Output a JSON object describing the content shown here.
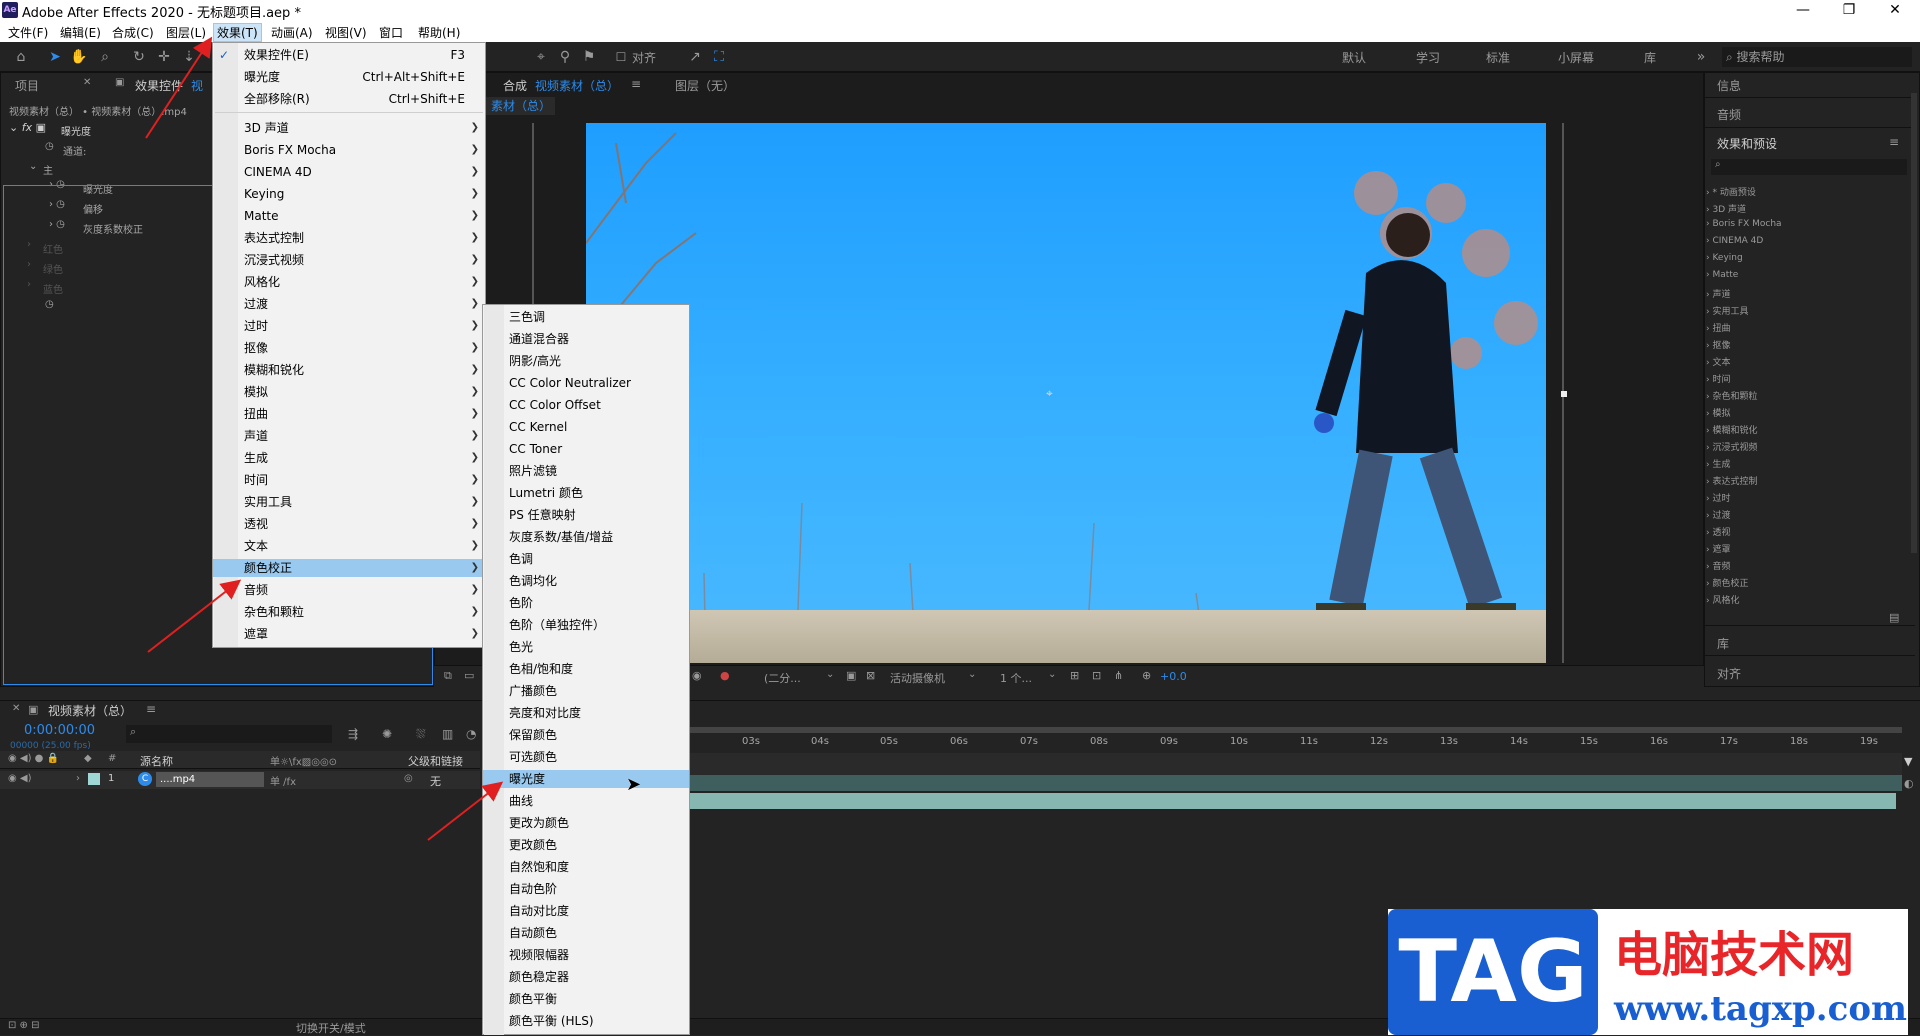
{
  "window": {
    "app_icon": "Ae",
    "title": "Adobe After Effects 2020 - 无标题项目.aep *",
    "min": "—",
    "max": "❐",
    "close": "✕"
  },
  "menubar": [
    "文件(F)",
    "编辑(E)",
    "合成(C)",
    "图层(L)",
    "效果(T)",
    "动画(A)",
    "视图(V)",
    "窗口",
    "帮助(H)"
  ],
  "toolbar": {
    "snap_label": "对齐",
    "workspaces": [
      "默认",
      "学习",
      "标准",
      "小屏幕",
      "库"
    ],
    "search_help": "搜索帮助"
  },
  "left_panel": {
    "tabs": [
      "项目",
      "效果控件",
      "视"
    ],
    "breadcrumb": "视频素材（总） • 视频素材（总）.mp4",
    "effect_name": "曝光度",
    "rows": [
      "通道:",
      "主",
      "曝光度",
      "偏移",
      "灰度系数校正",
      "红色",
      "绿色",
      "蓝色"
    ]
  },
  "comp_panel": {
    "tab_prefix": "合成",
    "tab_name": "视频素材（总）",
    "layer_tab": "图层（无）",
    "comp_label": "素材（总）"
  },
  "viewer_bar": {
    "resolution": "(二分...",
    "camera": "活动摄像机",
    "views": "1 个...",
    "exposure": "+0.0"
  },
  "effects_menu": {
    "items": [
      {
        "label": "效果控件(E)",
        "shortcut": "F3",
        "checked": true
      },
      {
        "label": "曝光度",
        "shortcut": "Ctrl+Alt+Shift+E"
      },
      {
        "label": "全部移除(R)",
        "shortcut": "Ctrl+Shift+E"
      }
    ],
    "categories": [
      "3D 声道",
      "Boris FX Mocha",
      "CINEMA 4D",
      "Keying",
      "Matte",
      "表达式控制",
      "沉浸式视频",
      "风格化",
      "过渡",
      "过时",
      "抠像",
      "模糊和锐化",
      "模拟",
      "扭曲",
      "声道",
      "生成",
      "时间",
      "实用工具",
      "透视",
      "文本",
      "颜色校正",
      "音频",
      "杂色和颗粒",
      "遮罩"
    ],
    "highlighted": "颜色校正"
  },
  "color_submenu": {
    "items": [
      "三色调",
      "通道混合器",
      "阴影/高光",
      "CC Color Neutralizer",
      "CC Color Offset",
      "CC Kernel",
      "CC Toner",
      "照片滤镜",
      "Lumetri 颜色",
      "PS 任意映射",
      "灰度系数/基值/增益",
      "色调",
      "色调均化",
      "色阶",
      "色阶（单独控件）",
      "色光",
      "色相/饱和度",
      "广播颜色",
      "亮度和对比度",
      "保留颜色",
      "可选颜色",
      "曝光度",
      "曲线",
      "更改为颜色",
      "更改颜色",
      "自然饱和度",
      "自动色阶",
      "自动对比度",
      "自动颜色",
      "视频限幅器",
      "颜色稳定器",
      "颜色平衡",
      "颜色平衡 (HLS)"
    ],
    "highlighted": "曝光度"
  },
  "right_panel": {
    "sections": [
      "信息",
      "音频",
      "效果和预设",
      "库",
      "对齐"
    ],
    "presets": [
      "* 动画预设",
      "3D 声道",
      "Boris FX Mocha",
      "CINEMA 4D",
      "Keying",
      "Matte",
      "声道",
      "实用工具",
      "扭曲",
      "抠像",
      "文本",
      "时间",
      "杂色和颗粒",
      "模拟",
      "模糊和锐化",
      "沉浸式视频",
      "生成",
      "表达式控制",
      "过时",
      "过渡",
      "透视",
      "遮罩",
      "音频",
      "颜色校正",
      "风格化"
    ]
  },
  "timeline": {
    "tab": "视频素材（总）",
    "timecode": "0:00:00:00",
    "fps": "00000 (25.00 fps)",
    "col_name": "源名称",
    "col_parent": "父级和链接",
    "layer_num": "1",
    "layer_name": "....mp4",
    "parent_value": "无",
    "ticks": [
      "03s",
      "04s",
      "05s",
      "06s",
      "07s",
      "08s",
      "09s",
      "10s",
      "11s",
      "12s",
      "13s",
      "14s",
      "15s",
      "16s",
      "17s",
      "18s",
      "19s"
    ],
    "toggle_label": "切换开关/模式"
  },
  "watermark": {
    "logo": "TAG",
    "text": "电脑技术网",
    "url": "www.tagxp.com"
  },
  "colors": {
    "accent_blue": "#2d8ceb",
    "menu_highlight": "#99c9ef",
    "arrow_red": "#e02020"
  }
}
